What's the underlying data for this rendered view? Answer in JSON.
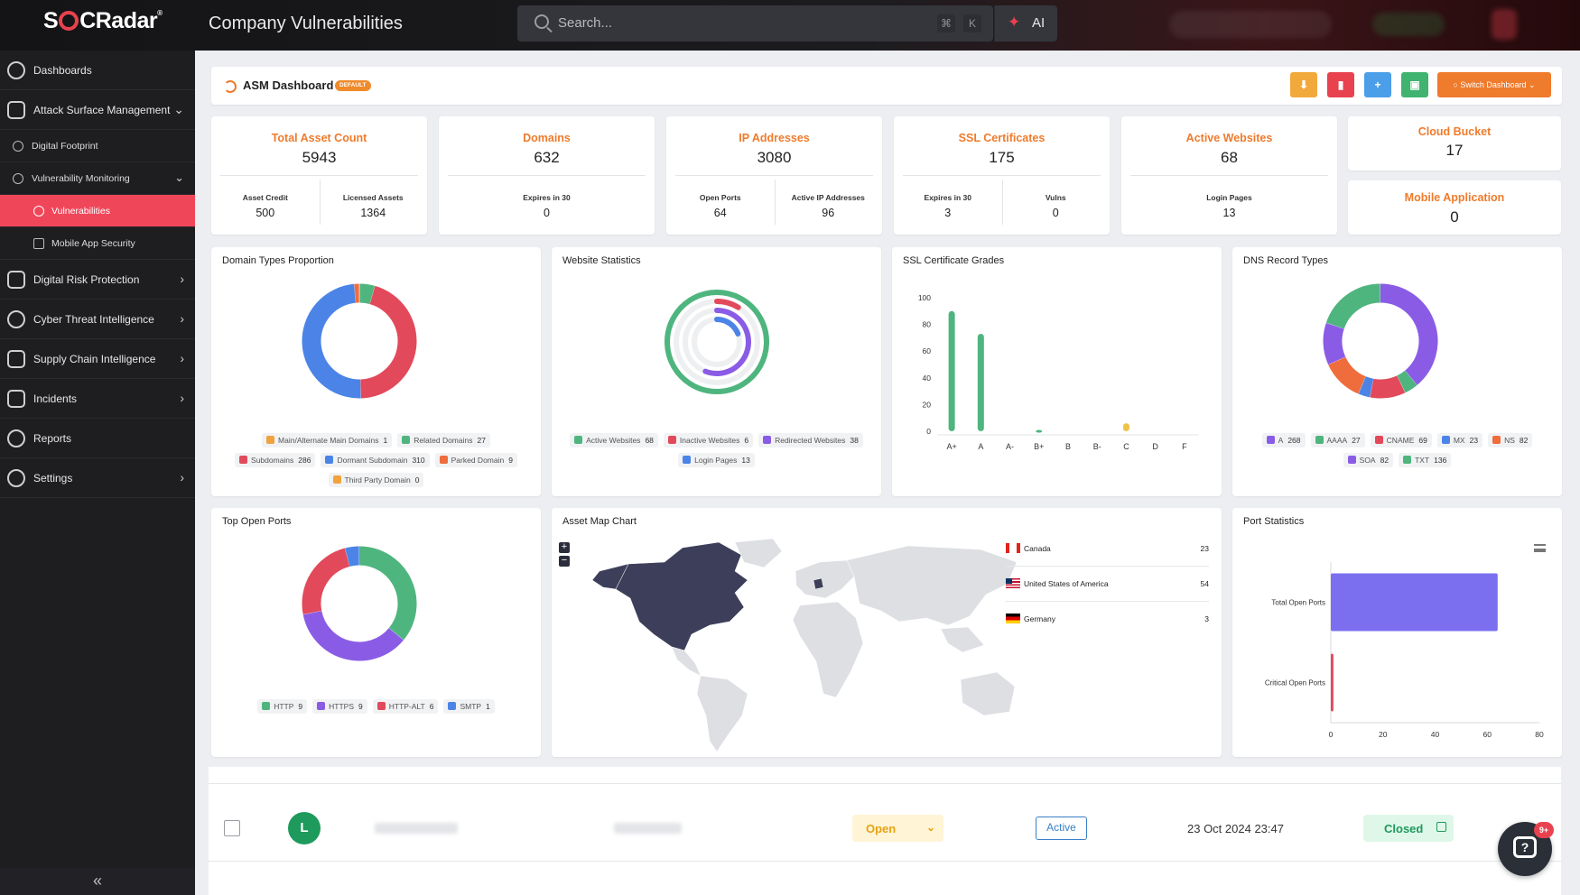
{
  "app": {
    "logo": "SOCRadar",
    "page_title": "Company Vulnerabilities",
    "search_placeholder": "Search...",
    "search_kbd_1": "⌘",
    "search_kbd_2": "K",
    "ai_label": "AI"
  },
  "sidebar": {
    "items": [
      {
        "label": "Dashboards",
        "icon": "dashboard-icon"
      },
      {
        "label": "Attack Surface Management",
        "icon": "shield-icon"
      },
      {
        "label": "Digital Footprint",
        "icon": "globe-icon"
      },
      {
        "label": "Vulnerability Monitoring",
        "icon": "bug-icon"
      },
      {
        "label": "Vulnerabilities",
        "icon": "bug-icon"
      },
      {
        "label": "Mobile App Security",
        "icon": "mobile-icon"
      },
      {
        "label": "Digital Risk Protection",
        "icon": "hand-icon"
      },
      {
        "label": "Cyber Threat Intelligence",
        "icon": "eye-icon"
      },
      {
        "label": "Supply Chain Intelligence",
        "icon": "chain-icon"
      },
      {
        "label": "Incidents",
        "icon": "alert-icon"
      },
      {
        "label": "Reports",
        "icon": "report-icon"
      },
      {
        "label": "Settings",
        "icon": "gear-icon"
      }
    ],
    "collapse_glyph": "«"
  },
  "dashboard": {
    "title": "ASM Dashboard",
    "badge": "DEFAULT",
    "switch_label": "Switch Dashboard",
    "colors": {
      "orange": "#ef7b2c",
      "red": "#e8424f",
      "blue": "#4b9ee8",
      "green": "#3fb36f"
    }
  },
  "stats": {
    "total_asset": {
      "title": "Total Asset Count",
      "value": "5943",
      "sub1_label": "Asset Credit",
      "sub1_value": "500",
      "sub2_label": "Licensed Assets",
      "sub2_value": "1364"
    },
    "domains": {
      "title": "Domains",
      "value": "632",
      "sub1_label": "Expires in 30",
      "sub1_value": "0"
    },
    "ip": {
      "title": "IP Addresses",
      "value": "3080",
      "sub1_label": "Open Ports",
      "sub1_value": "64",
      "sub2_label": "Active IP Addresses",
      "sub2_value": "96"
    },
    "ssl": {
      "title": "SSL Certificates",
      "value": "175",
      "sub1_label": "Expires in 30",
      "sub1_value": "3",
      "sub2_label": "Vulns",
      "sub2_value": "0"
    },
    "websites": {
      "title": "Active Websites",
      "value": "68",
      "sub1_label": "Login Pages",
      "sub1_value": "13"
    },
    "cloud": {
      "title": "Cloud Bucket",
      "value": "17"
    },
    "mobile": {
      "title": "Mobile Application",
      "value": "0"
    }
  },
  "chart_data": [
    {
      "type": "pie",
      "title": "Domain Types Proportion",
      "series": [
        {
          "name": "Main/Alternate Main Domains",
          "value": 1,
          "color": "#f0a23c"
        },
        {
          "name": "Related Domains",
          "value": 27,
          "color": "#4fb57f"
        },
        {
          "name": "Subdomains",
          "value": 286,
          "color": "#e2495a"
        },
        {
          "name": "Dormant Subdomain",
          "value": 310,
          "color": "#4b84e6"
        },
        {
          "name": "Parked Domain",
          "value": 9,
          "color": "#ef6d3c"
        },
        {
          "name": "Third Party Domain",
          "value": 0,
          "color": "#f0a23c"
        }
      ]
    },
    {
      "type": "pie",
      "title": "Website Statistics",
      "series": [
        {
          "name": "Active Websites",
          "value": 68,
          "color": "#4fb57f"
        },
        {
          "name": "Inactive Websites",
          "value": 6,
          "color": "#e2495a"
        },
        {
          "name": "Redirected Websites",
          "value": 38,
          "color": "#8a5ce6"
        },
        {
          "name": "Login Pages",
          "value": 13,
          "color": "#4b84e6"
        }
      ]
    },
    {
      "type": "bar",
      "title": "SSL Certificate Grades",
      "categories": [
        "A+",
        "A",
        "A-",
        "B+",
        "B",
        "B-",
        "C",
        "D",
        "F"
      ],
      "values": [
        90,
        73,
        0,
        1,
        0,
        0,
        6,
        0,
        0
      ],
      "ylim": [
        0,
        100
      ],
      "yticks": [
        "0",
        "20",
        "40",
        "60",
        "80",
        "100"
      ],
      "color": "#4fb57f",
      "c_color": "#f0c24a"
    },
    {
      "type": "pie",
      "title": "DNS Record Types",
      "series": [
        {
          "name": "A",
          "value": 268,
          "color": "#8a5ce6"
        },
        {
          "name": "AAAA",
          "value": 27,
          "color": "#4fb57f"
        },
        {
          "name": "CNAME",
          "value": 69,
          "color": "#e2495a"
        },
        {
          "name": "MX",
          "value": 23,
          "color": "#4b84e6"
        },
        {
          "name": "NS",
          "value": 82,
          "color": "#ef6d3c"
        },
        {
          "name": "SOA",
          "value": 82,
          "color": "#8a5ce6"
        },
        {
          "name": "TXT",
          "value": 136,
          "color": "#4fb57f"
        }
      ]
    },
    {
      "type": "pie",
      "title": "Top Open Ports",
      "series": [
        {
          "name": "HTTP",
          "value": 9,
          "color": "#4fb57f"
        },
        {
          "name": "HTTPS",
          "value": 9,
          "color": "#8a5ce6"
        },
        {
          "name": "HTTP-ALT",
          "value": 6,
          "color": "#e2495a"
        },
        {
          "name": "SMTP",
          "value": 1,
          "color": "#4b84e6"
        }
      ]
    },
    {
      "type": "table",
      "title": "Asset Map Chart",
      "rows": [
        {
          "country": "Canada",
          "value": "23"
        },
        {
          "country": "United States of America",
          "value": "54"
        },
        {
          "country": "Germany",
          "value": "3"
        }
      ]
    },
    {
      "type": "bar",
      "title": "Port Statistics",
      "orientation": "horizontal",
      "categories": [
        "Total Open Ports",
        "Critical Open Ports"
      ],
      "values": [
        64,
        1
      ],
      "xlim": [
        0,
        80
      ],
      "xticks": [
        "0",
        "20",
        "40",
        "60",
        "80"
      ],
      "colors": [
        "#7b6ff0",
        "#e2495a"
      ]
    }
  ],
  "row": {
    "avatar": "L",
    "status": "Open",
    "state": "Active",
    "date": "23 Oct 2024 23:47",
    "result": "Closed"
  },
  "help_badge": "9+"
}
